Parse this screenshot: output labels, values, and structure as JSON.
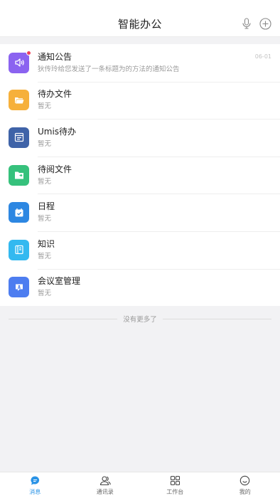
{
  "header": {
    "title": "智能办公"
  },
  "list": [
    {
      "title": "通知公告",
      "subtitle": "狄传玲给您发送了一条标题为的方法的通知公告",
      "time": "06-01",
      "color": "#8b63f0",
      "icon": "speaker-icon",
      "unread": true
    },
    {
      "title": "待办文件",
      "subtitle": "暂无",
      "color": "#f6b03b",
      "icon": "folder-open-icon"
    },
    {
      "title": "Umis待办",
      "subtitle": "暂无",
      "color": "#3f63a8",
      "icon": "window-icon"
    },
    {
      "title": "待阅文件",
      "subtitle": "暂无",
      "color": "#36c17c",
      "icon": "folder-arrow-icon"
    },
    {
      "title": "日程",
      "subtitle": "暂无",
      "color": "#2d87e2",
      "icon": "calendar-check-icon"
    },
    {
      "title": "知识",
      "subtitle": "暂无",
      "color": "#33b9f0",
      "icon": "book-icon"
    },
    {
      "title": "会议室管理",
      "subtitle": "暂无",
      "color": "#4d7df0",
      "icon": "meeting-room-icon"
    }
  ],
  "end_text": "没有更多了",
  "tabs": [
    {
      "label": "消息",
      "icon": "message-icon",
      "active": true
    },
    {
      "label": "通讯录",
      "icon": "contacts-icon"
    },
    {
      "label": "工作台",
      "icon": "grid-icon"
    },
    {
      "label": "我的",
      "icon": "smile-icon"
    }
  ],
  "colors": {
    "accent": "#2a93e6",
    "unread_dot": "#f0405a"
  }
}
